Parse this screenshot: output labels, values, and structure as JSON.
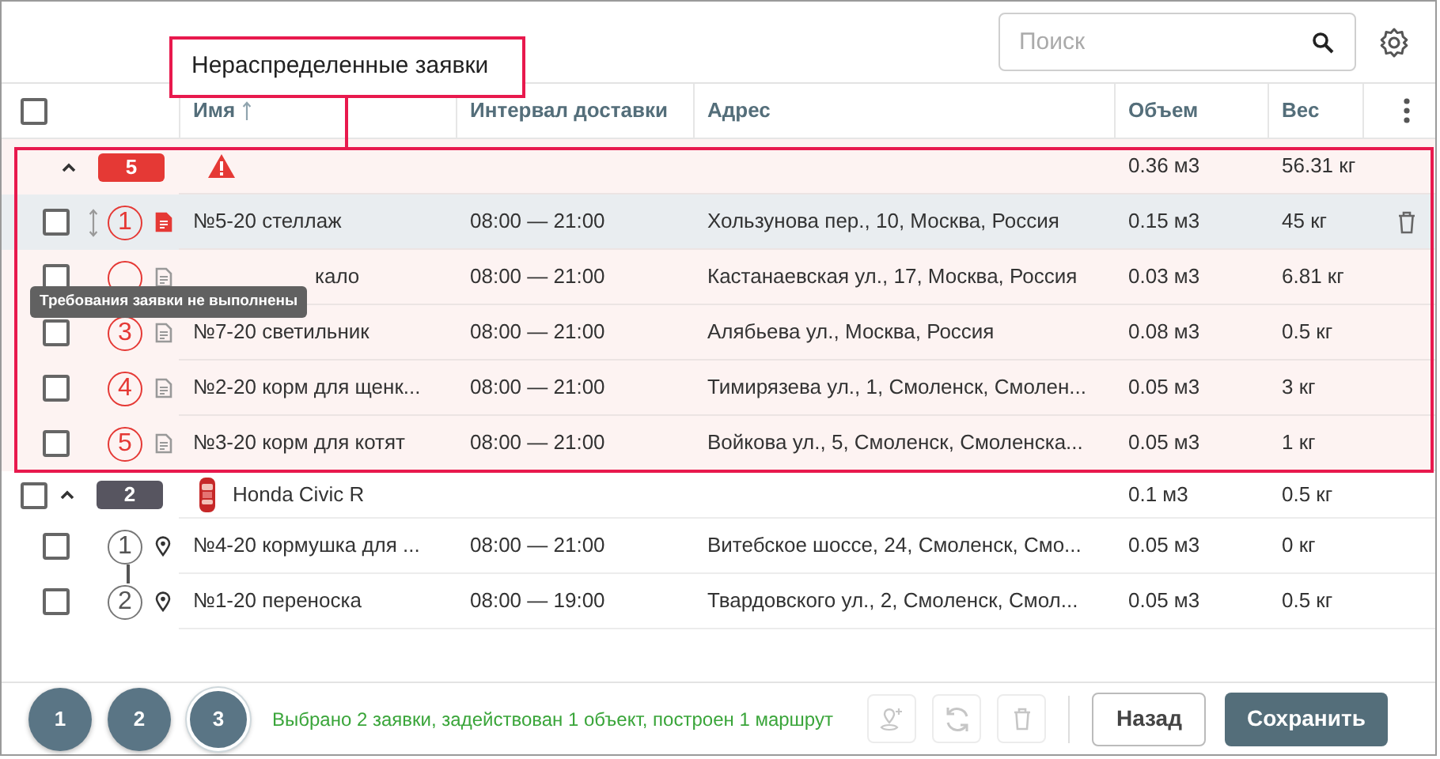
{
  "toolbar": {
    "search": {
      "placeholder": "Поиск"
    }
  },
  "callout": {
    "label": "Нераспределенные заявки"
  },
  "table": {
    "header_checkbox": {
      "checked": false
    },
    "columns": [
      {
        "label": "Имя",
        "sorted": true
      },
      {
        "label": "Интервал доставки"
      },
      {
        "label": "Адрес"
      },
      {
        "label": "Объем"
      },
      {
        "label": "Вес"
      }
    ],
    "groups": [
      {
        "kind": "unassigned",
        "count": "5",
        "expanded": true,
        "volume": "0.36 м3",
        "weight": "56.31 кг",
        "rows": [
          {
            "kind": "document",
            "number": "1",
            "alert": true,
            "hovered": true,
            "checked": false,
            "name": "№5-20 стеллаж",
            "interval": "08:00 — 21:00",
            "address": "Хользунова пер., 10, Москва, Россия",
            "volume": "0.15 м3",
            "weight": "45 кг",
            "tooltip": "Требования заявки не выполнены"
          },
          {
            "kind": "document",
            "alert": false,
            "hovered": false,
            "checked": false,
            "name": "кало",
            "interval": "08:00 — 21:00",
            "address": "Кастанаевская ул., 17, Москва, Россия",
            "volume": "0.03 м3",
            "weight": "6.81 кг"
          },
          {
            "kind": "document",
            "number": "3",
            "alert": false,
            "hovered": false,
            "checked": false,
            "name": "№7-20 светильник",
            "interval": "08:00 — 21:00",
            "address": "Алябьева ул., Москва, Россия",
            "volume": "0.08 м3",
            "weight": "0.5 кг"
          },
          {
            "kind": "document",
            "number": "4",
            "alert": false,
            "hovered": false,
            "checked": false,
            "name": "№2-20 корм для щенк...",
            "interval": "08:00 — 21:00",
            "address": "Тимирязева ул., 1, Смоленск, Смолен...",
            "volume": "0.05 м3",
            "weight": "3 кг"
          },
          {
            "kind": "document",
            "number": "5",
            "alert": false,
            "hovered": false,
            "checked": false,
            "name": "№3-20 корм для котят",
            "interval": "08:00 — 21:00",
            "address": "Войкова ул., 5, Смоленск, Смоленска...",
            "volume": "0.05 м3",
            "weight": "1 кг"
          }
        ]
      },
      {
        "kind": "vehicle",
        "count": "2",
        "expanded": true,
        "checked": false,
        "title": "Honda Civic R",
        "volume": "0.1 м3",
        "weight": "0.5 кг",
        "rows": [
          {
            "kind": "pin",
            "number": "1",
            "hovered": false,
            "checked": false,
            "name": "№4-20 кормушка для ...",
            "interval": "08:00 — 21:00",
            "address": "Витебское шоссе, 24, Смоленск, Смо...",
            "volume": "0.05 м3",
            "weight": "0 кг"
          },
          {
            "kind": "pin",
            "number": "2",
            "hovered": false,
            "checked": false,
            "name": "№1-20 переноска",
            "interval": "08:00 — 19:00",
            "address": "Твардовского ул., 2, Смоленск, Смол...",
            "volume": "0.05 м3",
            "weight": "0.5 кг"
          }
        ]
      }
    ]
  },
  "footer": {
    "steps": [
      {
        "label": "1",
        "selected": false
      },
      {
        "label": "2",
        "selected": false
      },
      {
        "label": "3",
        "selected": true
      }
    ],
    "status": "Выбрано 2 заявки, задействован 1 объект, построен 1 маршрут",
    "tools": [
      {
        "kind": "add-pin",
        "disabled": true
      },
      {
        "kind": "refresh",
        "disabled": true
      },
      {
        "kind": "delete",
        "disabled": true
      }
    ],
    "buttons": [
      {
        "kind": "secondary",
        "label": "Назад"
      },
      {
        "kind": "primary",
        "label": "Сохранить"
      }
    ]
  }
}
